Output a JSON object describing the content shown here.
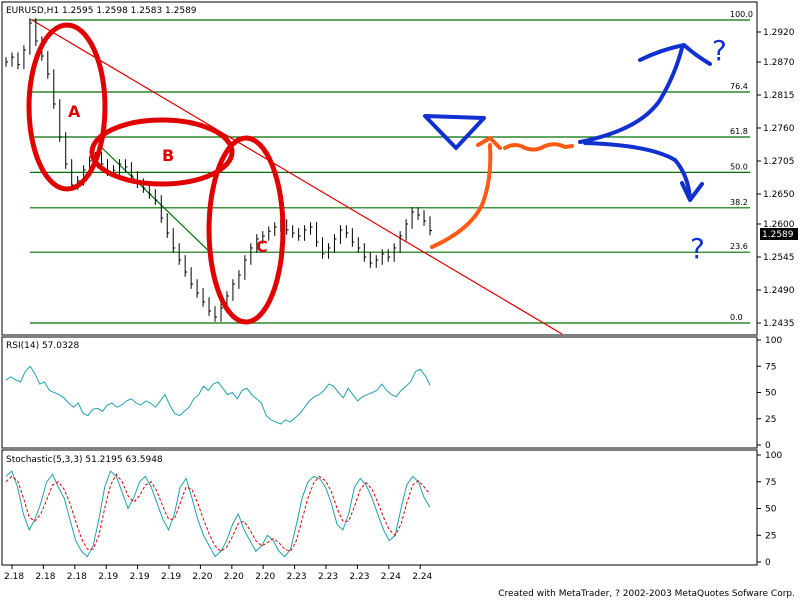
{
  "chart_data": [
    {
      "type": "line",
      "panel": "price",
      "header": "EURUSD,H1  1.2595 1.2598 1.2583 1.2589",
      "ylim": [
        1.2415,
        1.2955
      ],
      "ytick_labels": [
        "1.2920",
        "1.2870",
        "1.2815",
        "1.2760",
        "1.2705",
        "1.2650",
        "1.2600",
        "1.2545",
        "1.2490",
        "1.2435"
      ],
      "ytick_values": [
        1.292,
        1.287,
        1.2815,
        1.276,
        1.2705,
        1.265,
        1.26,
        1.2545,
        1.249,
        1.2435
      ],
      "last_price_label": "1.2589",
      "last_price": 1.2589,
      "fib_levels": [
        {
          "label": "100.0",
          "price": 1.294
        },
        {
          "label": "76.4",
          "price": 1.282
        },
        {
          "label": "61.8",
          "price": 1.2745
        },
        {
          "label": "50.0",
          "price": 1.2686
        },
        {
          "label": "38.2",
          "price": 1.2627
        },
        {
          "label": "23.6",
          "price": 1.2553
        },
        {
          "label": "0.0",
          "price": 1.2435
        }
      ],
      "price_series": [
        1.287,
        1.2878,
        1.2866,
        1.289,
        1.2935,
        1.2905,
        1.288,
        1.285,
        1.28,
        1.2745,
        1.27,
        1.2665,
        1.2672,
        1.269,
        1.2705,
        1.2712,
        1.27,
        1.2688,
        1.269,
        1.27,
        1.2695,
        1.268,
        1.2668,
        1.266,
        1.265,
        1.264,
        1.261,
        1.2585,
        1.256,
        1.254,
        1.252,
        1.25,
        1.2485,
        1.247,
        1.2455,
        1.2445,
        1.246,
        1.248,
        1.25,
        1.2515,
        1.254,
        1.256,
        1.2575,
        1.258,
        1.2588,
        1.2595,
        1.26,
        1.259,
        1.2585,
        1.258,
        1.259,
        1.2595,
        1.257,
        1.255,
        1.256,
        1.2575,
        1.259,
        1.2585,
        1.257,
        1.256,
        1.2545,
        1.2535,
        1.254,
        1.255,
        1.2545,
        1.256,
        1.258,
        1.26,
        1.262,
        1.2615,
        1.2605,
        1.2589
      ],
      "annotations": [
        "A",
        "B",
        "C",
        "?",
        "?"
      ]
    },
    {
      "type": "line",
      "panel": "rsi",
      "header": "RSI(14)  57.0328",
      "ylim": [
        0,
        100
      ],
      "ytick_labels": [
        "100",
        "75",
        "50",
        "25",
        "0"
      ],
      "ytick_values": [
        100,
        75,
        50,
        25,
        0
      ],
      "series": [
        {
          "values": [
            62,
            65,
            62,
            60,
            70,
            75,
            68,
            58,
            60,
            52,
            50,
            48,
            45,
            40,
            36,
            40,
            30,
            28,
            34,
            35,
            32,
            38,
            40,
            36,
            38,
            42,
            44,
            40,
            38,
            42,
            40,
            36,
            42,
            48,
            38,
            30,
            28,
            32,
            36,
            44,
            48,
            56,
            52,
            58,
            60,
            54,
            48,
            50,
            44,
            52,
            54,
            48,
            44,
            40,
            28,
            24,
            22,
            20,
            24,
            22,
            26,
            30,
            36,
            42,
            46,
            48,
            52,
            58,
            56,
            50,
            45,
            54,
            48,
            42,
            46,
            48,
            50,
            52,
            58,
            52,
            48,
            46,
            52,
            56,
            60,
            70,
            72,
            66,
            57
          ]
        }
      ]
    },
    {
      "type": "line",
      "panel": "stochastic",
      "header": "Stochastic(5,3,3)  51.2195  63.5948",
      "ylim": [
        0,
        100
      ],
      "ytick_labels": [
        "100",
        "75",
        "50",
        "25",
        "0"
      ],
      "ytick_values": [
        100,
        75,
        50,
        25,
        0
      ],
      "series": [
        {
          "values": [
            80,
            85,
            70,
            45,
            30,
            40,
            55,
            75,
            82,
            70,
            60,
            40,
            20,
            10,
            5,
            15,
            40,
            70,
            85,
            80,
            65,
            50,
            60,
            75,
            80,
            70,
            55,
            40,
            30,
            45,
            70,
            78,
            60,
            40,
            25,
            15,
            5,
            10,
            20,
            35,
            45,
            30,
            20,
            10,
            15,
            25,
            20,
            10,
            5,
            12,
            35,
            60,
            75,
            80,
            78,
            70,
            55,
            35,
            30,
            45,
            70,
            78,
            72,
            60,
            45,
            30,
            20,
            25,
            50,
            72,
            80,
            75,
            60,
            51
          ]
        },
        {
          "values": [
            75,
            80,
            76,
            60,
            42,
            38,
            45,
            58,
            72,
            75,
            68,
            55,
            38,
            22,
            12,
            12,
            25,
            50,
            72,
            82,
            75,
            62,
            56,
            62,
            72,
            75,
            66,
            52,
            40,
            40,
            55,
            70,
            68,
            55,
            40,
            26,
            15,
            10,
            14,
            24,
            36,
            38,
            30,
            20,
            15,
            18,
            22,
            18,
            12,
            10,
            20,
            40,
            60,
            74,
            80,
            76,
            66,
            50,
            38,
            38,
            52,
            68,
            74,
            68,
            56,
            42,
            30,
            25,
            35,
            55,
            72,
            76,
            70,
            63.6
          ]
        }
      ]
    },
    {
      "type": "line",
      "panel": "time-axis",
      "x_tick_labels": [
        "2.18",
        "2.18",
        "2.18",
        "2.19",
        "2.19",
        "2.19",
        "2.20",
        "2.20",
        "2.20",
        "2.23",
        "2.23",
        "2.23",
        "2.24",
        "2.24"
      ]
    }
  ],
  "footer": "Created with MetaTrader, ? 2002-2003 MetaQuotes Sofware Corp.",
  "colors": {
    "price": "#000000",
    "fib_line": "#007000",
    "trend_line": "#e00000",
    "rsi": "#20a0b0",
    "stoch_main": "#20a0b0",
    "stoch_signal": "#e00000",
    "red_marker": "#e00000",
    "orange_marker": "#ff5a14",
    "blue_marker": "#1030d0"
  }
}
